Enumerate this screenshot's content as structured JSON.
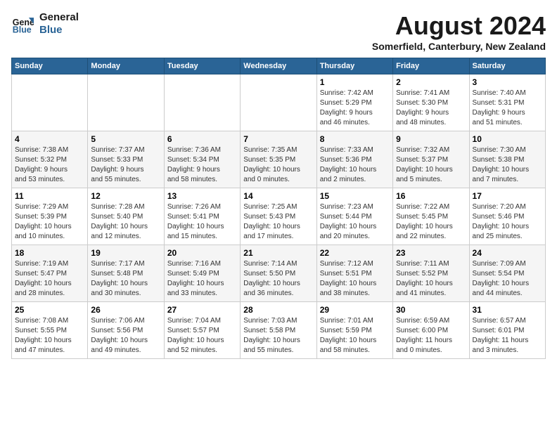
{
  "header": {
    "logo_line1": "General",
    "logo_line2": "Blue",
    "month_year": "August 2024",
    "location": "Somerfield, Canterbury, New Zealand"
  },
  "days_of_week": [
    "Sunday",
    "Monday",
    "Tuesday",
    "Wednesday",
    "Thursday",
    "Friday",
    "Saturday"
  ],
  "weeks": [
    [
      {
        "day": "",
        "detail": ""
      },
      {
        "day": "",
        "detail": ""
      },
      {
        "day": "",
        "detail": ""
      },
      {
        "day": "",
        "detail": ""
      },
      {
        "day": "1",
        "detail": "Sunrise: 7:42 AM\nSunset: 5:29 PM\nDaylight: 9 hours\nand 46 minutes."
      },
      {
        "day": "2",
        "detail": "Sunrise: 7:41 AM\nSunset: 5:30 PM\nDaylight: 9 hours\nand 48 minutes."
      },
      {
        "day": "3",
        "detail": "Sunrise: 7:40 AM\nSunset: 5:31 PM\nDaylight: 9 hours\nand 51 minutes."
      }
    ],
    [
      {
        "day": "4",
        "detail": "Sunrise: 7:38 AM\nSunset: 5:32 PM\nDaylight: 9 hours\nand 53 minutes."
      },
      {
        "day": "5",
        "detail": "Sunrise: 7:37 AM\nSunset: 5:33 PM\nDaylight: 9 hours\nand 55 minutes."
      },
      {
        "day": "6",
        "detail": "Sunrise: 7:36 AM\nSunset: 5:34 PM\nDaylight: 9 hours\nand 58 minutes."
      },
      {
        "day": "7",
        "detail": "Sunrise: 7:35 AM\nSunset: 5:35 PM\nDaylight: 10 hours\nand 0 minutes."
      },
      {
        "day": "8",
        "detail": "Sunrise: 7:33 AM\nSunset: 5:36 PM\nDaylight: 10 hours\nand 2 minutes."
      },
      {
        "day": "9",
        "detail": "Sunrise: 7:32 AM\nSunset: 5:37 PM\nDaylight: 10 hours\nand 5 minutes."
      },
      {
        "day": "10",
        "detail": "Sunrise: 7:30 AM\nSunset: 5:38 PM\nDaylight: 10 hours\nand 7 minutes."
      }
    ],
    [
      {
        "day": "11",
        "detail": "Sunrise: 7:29 AM\nSunset: 5:39 PM\nDaylight: 10 hours\nand 10 minutes."
      },
      {
        "day": "12",
        "detail": "Sunrise: 7:28 AM\nSunset: 5:40 PM\nDaylight: 10 hours\nand 12 minutes."
      },
      {
        "day": "13",
        "detail": "Sunrise: 7:26 AM\nSunset: 5:41 PM\nDaylight: 10 hours\nand 15 minutes."
      },
      {
        "day": "14",
        "detail": "Sunrise: 7:25 AM\nSunset: 5:43 PM\nDaylight: 10 hours\nand 17 minutes."
      },
      {
        "day": "15",
        "detail": "Sunrise: 7:23 AM\nSunset: 5:44 PM\nDaylight: 10 hours\nand 20 minutes."
      },
      {
        "day": "16",
        "detail": "Sunrise: 7:22 AM\nSunset: 5:45 PM\nDaylight: 10 hours\nand 22 minutes."
      },
      {
        "day": "17",
        "detail": "Sunrise: 7:20 AM\nSunset: 5:46 PM\nDaylight: 10 hours\nand 25 minutes."
      }
    ],
    [
      {
        "day": "18",
        "detail": "Sunrise: 7:19 AM\nSunset: 5:47 PM\nDaylight: 10 hours\nand 28 minutes."
      },
      {
        "day": "19",
        "detail": "Sunrise: 7:17 AM\nSunset: 5:48 PM\nDaylight: 10 hours\nand 30 minutes."
      },
      {
        "day": "20",
        "detail": "Sunrise: 7:16 AM\nSunset: 5:49 PM\nDaylight: 10 hours\nand 33 minutes."
      },
      {
        "day": "21",
        "detail": "Sunrise: 7:14 AM\nSunset: 5:50 PM\nDaylight: 10 hours\nand 36 minutes."
      },
      {
        "day": "22",
        "detail": "Sunrise: 7:12 AM\nSunset: 5:51 PM\nDaylight: 10 hours\nand 38 minutes."
      },
      {
        "day": "23",
        "detail": "Sunrise: 7:11 AM\nSunset: 5:52 PM\nDaylight: 10 hours\nand 41 minutes."
      },
      {
        "day": "24",
        "detail": "Sunrise: 7:09 AM\nSunset: 5:54 PM\nDaylight: 10 hours\nand 44 minutes."
      }
    ],
    [
      {
        "day": "25",
        "detail": "Sunrise: 7:08 AM\nSunset: 5:55 PM\nDaylight: 10 hours\nand 47 minutes."
      },
      {
        "day": "26",
        "detail": "Sunrise: 7:06 AM\nSunset: 5:56 PM\nDaylight: 10 hours\nand 49 minutes."
      },
      {
        "day": "27",
        "detail": "Sunrise: 7:04 AM\nSunset: 5:57 PM\nDaylight: 10 hours\nand 52 minutes."
      },
      {
        "day": "28",
        "detail": "Sunrise: 7:03 AM\nSunset: 5:58 PM\nDaylight: 10 hours\nand 55 minutes."
      },
      {
        "day": "29",
        "detail": "Sunrise: 7:01 AM\nSunset: 5:59 PM\nDaylight: 10 hours\nand 58 minutes."
      },
      {
        "day": "30",
        "detail": "Sunrise: 6:59 AM\nSunset: 6:00 PM\nDaylight: 11 hours\nand 0 minutes."
      },
      {
        "day": "31",
        "detail": "Sunrise: 6:57 AM\nSunset: 6:01 PM\nDaylight: 11 hours\nand 3 minutes."
      }
    ]
  ]
}
